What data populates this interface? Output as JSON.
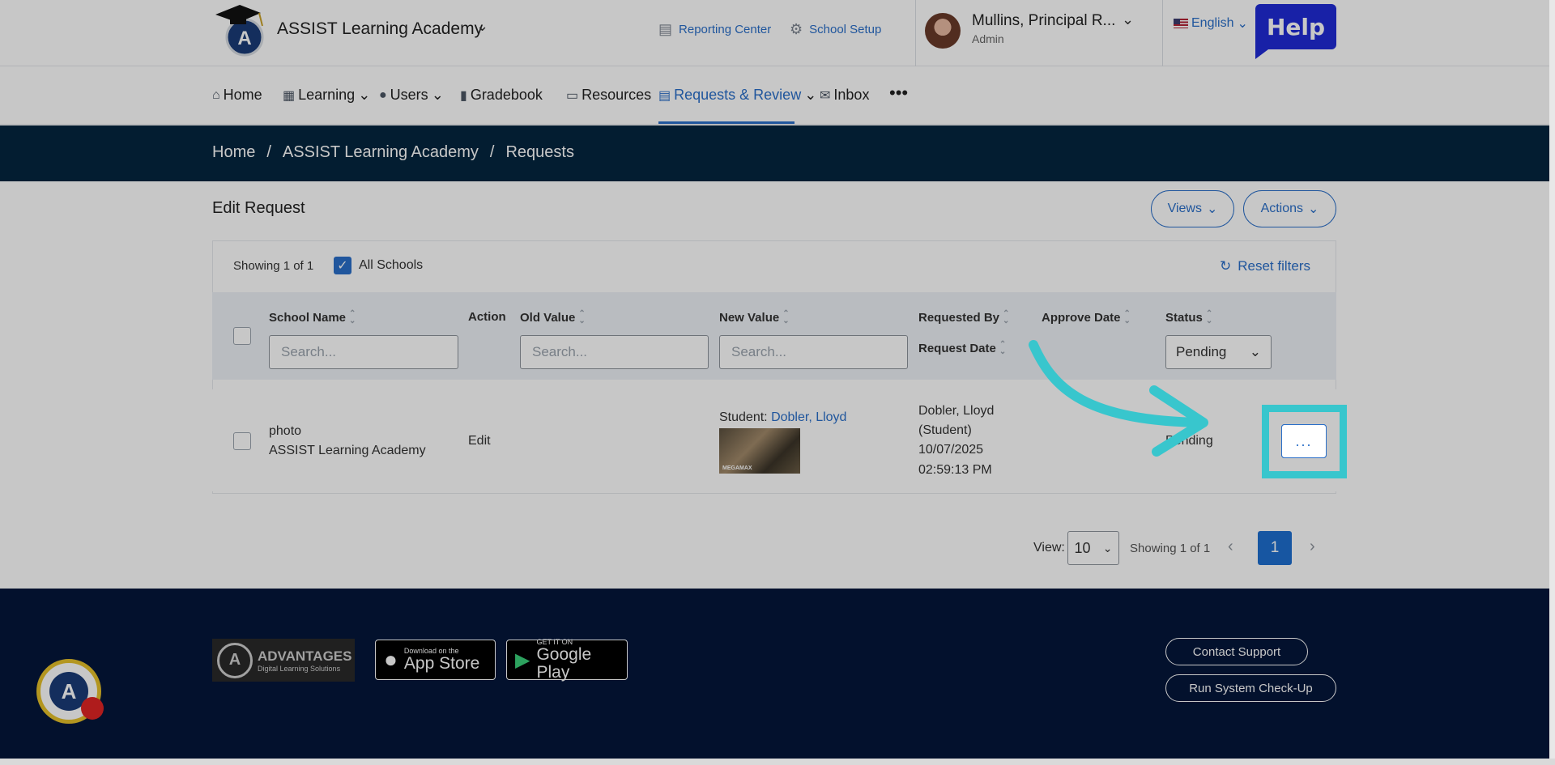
{
  "header": {
    "school_name": "ASSIST Learning Academy",
    "reporting_center": "Reporting Center",
    "school_setup": "School Setup",
    "user_name": "Mullins, Principal R...",
    "user_role": "Admin",
    "language": "English",
    "help": "Help"
  },
  "nav": {
    "items": [
      {
        "label": "Home",
        "icon": "home-icon"
      },
      {
        "label": "Learning",
        "icon": "learning-icon"
      },
      {
        "label": "Users",
        "icon": "user-icon"
      },
      {
        "label": "Gradebook",
        "icon": "book-icon"
      },
      {
        "label": "Resources",
        "icon": "monitor-icon"
      },
      {
        "label": "Requests & Review",
        "icon": "clipboard-icon"
      },
      {
        "label": "Inbox",
        "icon": "mail-icon"
      }
    ],
    "more": "•••"
  },
  "breadcrumb": [
    "Home",
    "/",
    "ASSIST Learning Academy",
    "/",
    "Requests"
  ],
  "page": {
    "title": "Edit Request",
    "views_label": "Views",
    "actions_label": "Actions",
    "showing": "Showing 1 of 1",
    "all_schools": "All Schools",
    "reset_filters": "Reset filters"
  },
  "table": {
    "headers": {
      "school_name": "School Name",
      "action": "Action",
      "old_value": "Old Value",
      "new_value": "New Value",
      "requested_by": "Requested By",
      "request_date": "Request Date",
      "approve_date": "Approve Date",
      "status": "Status"
    },
    "search_placeholder": "Search...",
    "status_filter": "Pending",
    "rows": [
      {
        "field": "photo",
        "school": "ASSIST Learning Academy",
        "action": "Edit",
        "new_value_prefix": "Student:",
        "new_value_link": "Dobler, Lloyd",
        "thumb_label": "MEGAMAX",
        "requested_by": "Dobler, Lloyd",
        "requested_role": "(Student)",
        "request_date": "10/07/2025",
        "request_time": "02:59:13 PM",
        "status": "Pending",
        "more_label": "..."
      }
    ]
  },
  "pagination": {
    "view_label": "View:",
    "page_size": "10",
    "showing": "Showing 1 of 1",
    "current_page": "1"
  },
  "footer": {
    "advantages_title": "ADVANTAGES",
    "advantages_sub": "Digital Learning Solutions",
    "appstore_small": "Download on the",
    "appstore_big": "App Store",
    "googleplay_small": "GET IT ON",
    "googleplay_big": "Google Play",
    "contact_support": "Contact Support",
    "run_check": "Run System Check-Up"
  },
  "colors": {
    "accent": "#2a6fc9",
    "dark_band": "#04263f",
    "footer": "#04163a",
    "highlight": "#38c6cd"
  }
}
